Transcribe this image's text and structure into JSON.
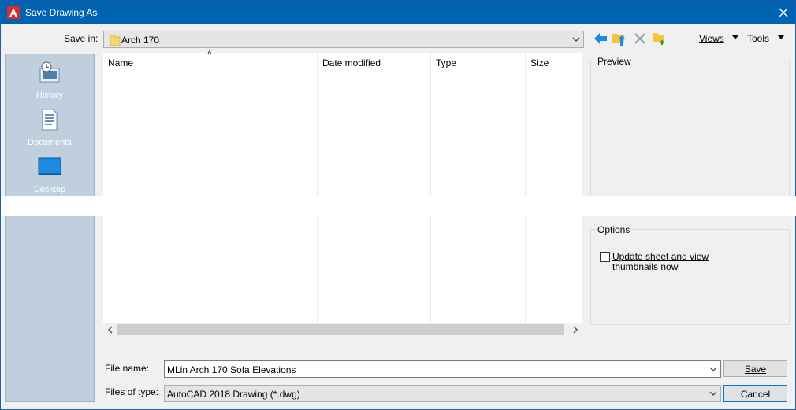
{
  "titlebar": {
    "title": "Save Drawing As",
    "app_icon": "autocad-icon",
    "close_icon": "close-icon"
  },
  "toolbar": {
    "save_in_label": "Save in:",
    "save_in_value": "Arch 170",
    "folder_icon": "folder-icon",
    "icons": [
      "back-icon",
      "up-folder-icon",
      "delete-icon",
      "new-folder-icon"
    ],
    "views_label": "Views",
    "tools_label": "Tools"
  },
  "places": [
    {
      "label": "History",
      "icon": "history-icon"
    },
    {
      "label": "Documents",
      "icon": "documents-icon"
    },
    {
      "label": "Desktop",
      "icon": "desktop-icon"
    }
  ],
  "filelist": {
    "columns": [
      "Name",
      "Date modified",
      "Type",
      "Size"
    ],
    "sort_indicator": "^",
    "rows": []
  },
  "preview": {
    "title": "Preview"
  },
  "options": {
    "title": "Options",
    "checkbox_label_line1": "Update sheet and view",
    "checkbox_label_line2": "thumbnails now",
    "checked": false
  },
  "form": {
    "file_name_label": "File name:",
    "file_name_value": "MLin Arch 170 Sofa Elevations",
    "file_type_label": "Files of type:",
    "file_type_value": "AutoCAD 2018 Drawing (*.dwg)",
    "save_label": "Save",
    "cancel_label": "Cancel"
  },
  "colors": {
    "titlebar": "#0063b1",
    "accent_blue": "#1e88e5",
    "places_bg": "#bfcfdd",
    "folder_yellow": "#f7c948"
  }
}
